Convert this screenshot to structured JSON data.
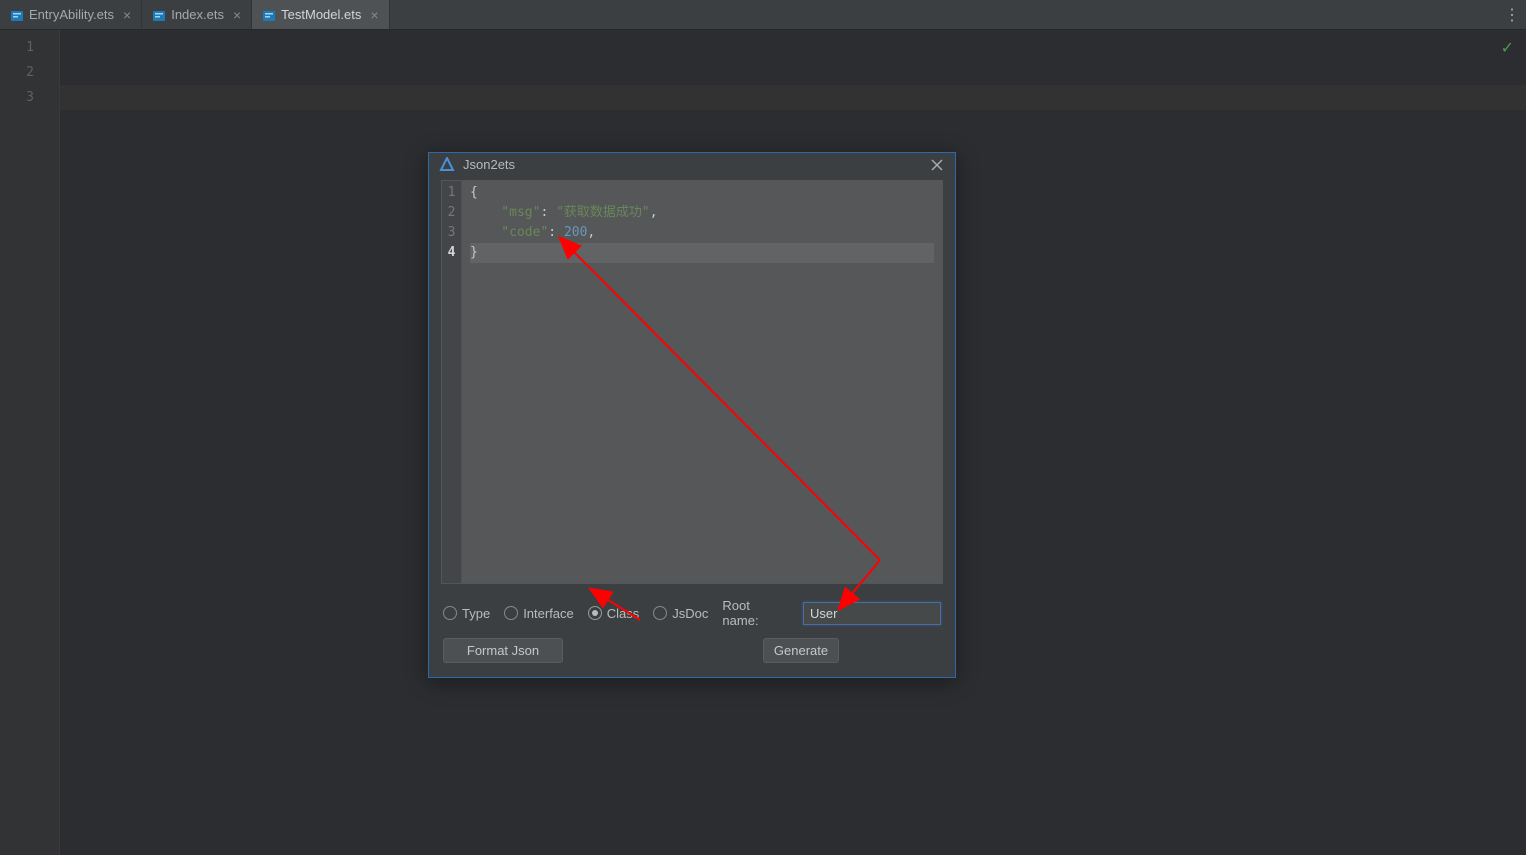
{
  "tabs": [
    {
      "label": "EntryAbility.ets",
      "active": false
    },
    {
      "label": "Index.ets",
      "active": false
    },
    {
      "label": "TestModel.ets",
      "active": true
    }
  ],
  "gutter_lines": [
    "1",
    "2",
    "3"
  ],
  "dialog": {
    "title": "Json2ets",
    "json_lines": [
      {
        "n": "1",
        "tokens": [
          {
            "t": "{",
            "c": "j-brace"
          }
        ]
      },
      {
        "n": "2",
        "tokens": [
          {
            "t": "    \"msg\"",
            "c": "j-key"
          },
          {
            "t": ": ",
            "c": "j-punc"
          },
          {
            "t": "\"获取数据成功\"",
            "c": "j-str"
          },
          {
            "t": ",",
            "c": "j-punc"
          }
        ]
      },
      {
        "n": "3",
        "tokens": [
          {
            "t": "    \"code\"",
            "c": "j-key"
          },
          {
            "t": ": ",
            "c": "j-punc"
          },
          {
            "t": "200",
            "c": "j-num"
          },
          {
            "t": ",",
            "c": "j-punc"
          }
        ]
      },
      {
        "n": "4",
        "tokens": [
          {
            "t": "}",
            "c": "j-brace"
          }
        ],
        "current": true
      }
    ],
    "radios": [
      {
        "label": "Type",
        "checked": false
      },
      {
        "label": "Interface",
        "checked": false
      },
      {
        "label": "Class",
        "checked": true
      },
      {
        "label": "JsDoc",
        "checked": false
      }
    ],
    "root_label": "Root name:",
    "root_value": "User",
    "format_btn": "Format Json",
    "generate_btn": "Generate"
  }
}
